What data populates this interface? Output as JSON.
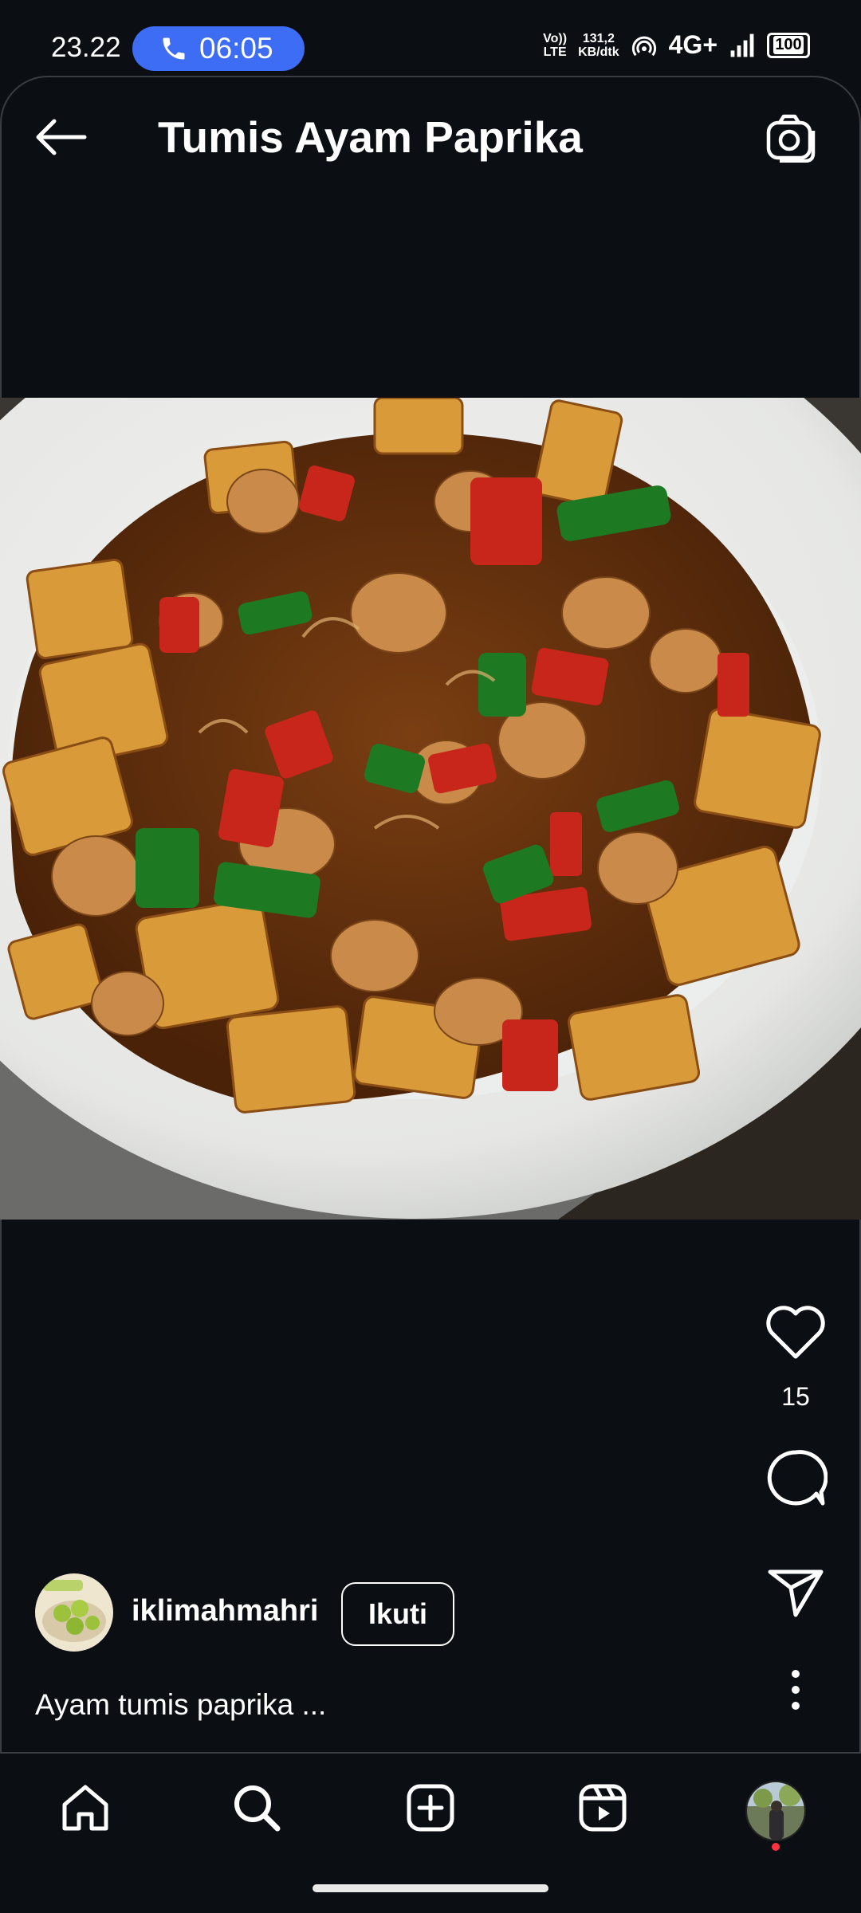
{
  "status_bar": {
    "time": "23.22",
    "call_timer": "06:05",
    "volte": "Vo)) LTE",
    "data_speed_value": "131,2",
    "data_speed_unit": "KB/dtk",
    "network": "4G+",
    "battery": "100"
  },
  "header": {
    "title": "Tumis Ayam Paprika",
    "back_icon": "arrow-left-icon",
    "camera_icon": "camera-icon"
  },
  "post": {
    "image_alt": "Tumis ayam paprika dish on a white plate",
    "like_count": "15",
    "username": "iklimahmahri",
    "follow_label": "Ikuti",
    "caption": "Ayam tumis paprika ..."
  },
  "nav": {
    "items": [
      "home-icon",
      "search-icon",
      "create-icon",
      "reels-icon",
      "profile-avatar"
    ]
  },
  "colors": {
    "background": "#0b0e13",
    "accent_call": "#3d6cf5",
    "notification_dot": "#ff3040"
  }
}
